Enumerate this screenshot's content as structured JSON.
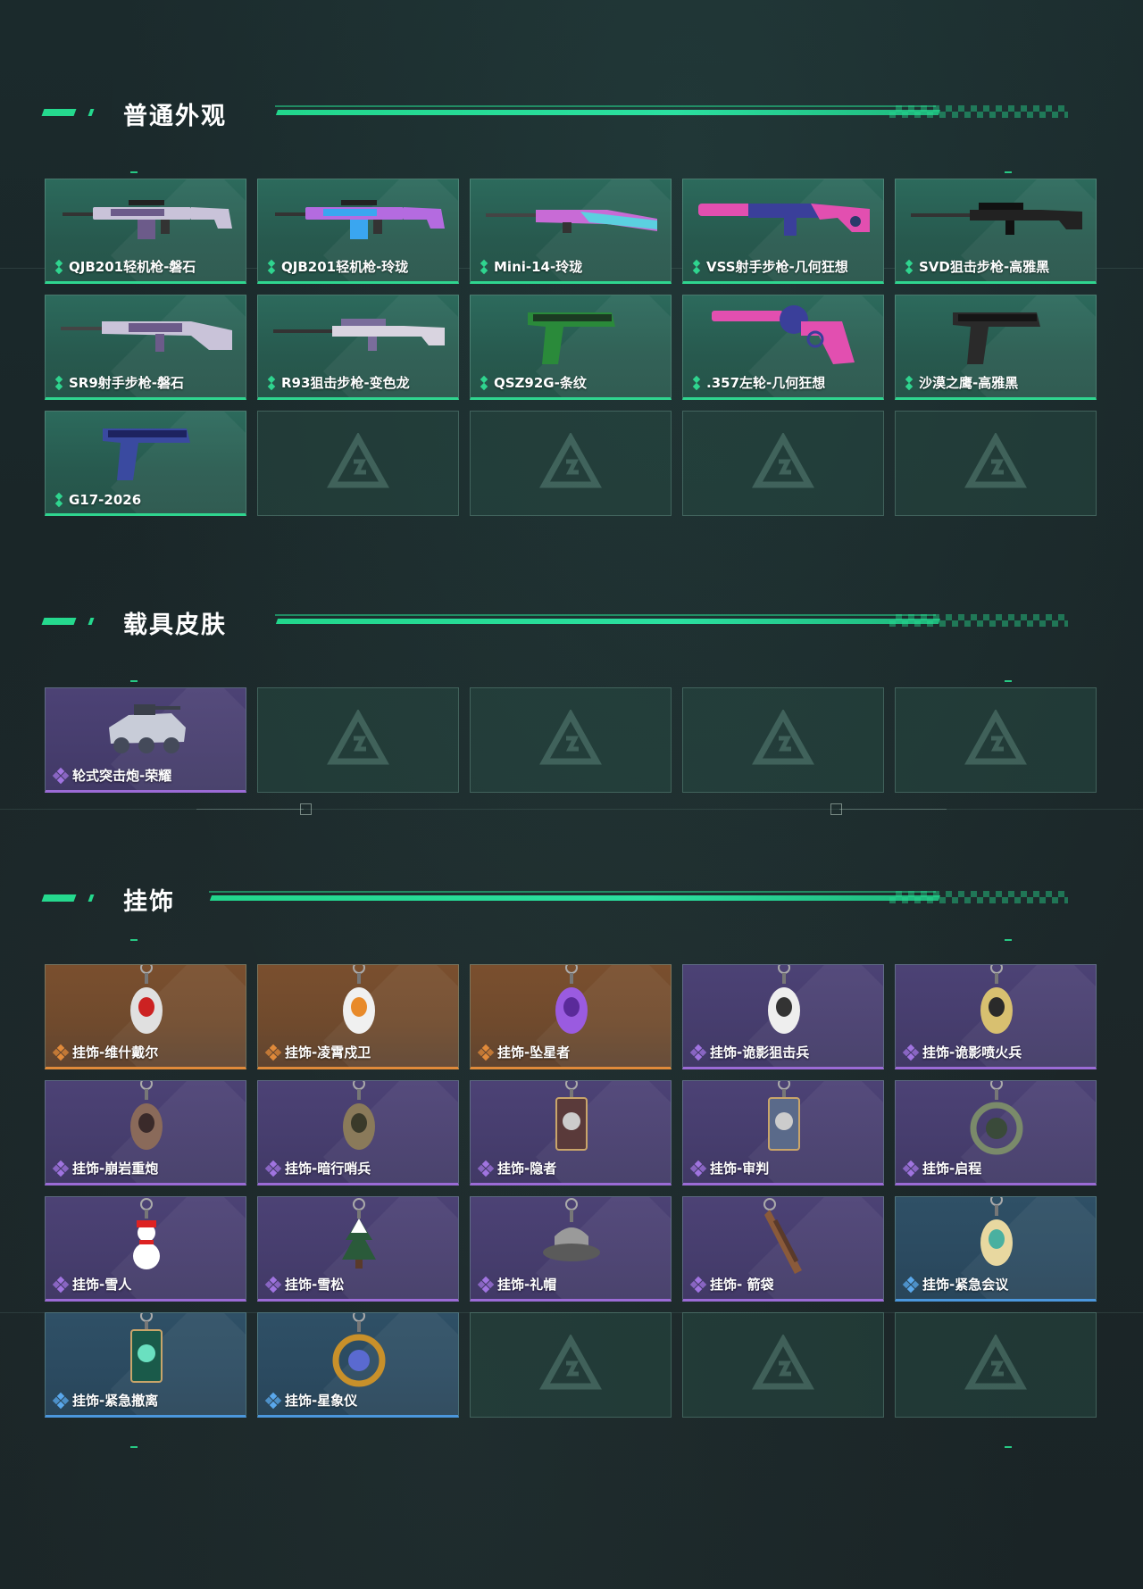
{
  "sections": {
    "normal": {
      "title": "普通外观",
      "items": [
        {
          "label": "QJB201轻机枪-磐石",
          "rarity": "green",
          "icon": "lmg-icon",
          "colors": [
            "#c9c3d9",
            "#6c5b8a"
          ]
        },
        {
          "label": "QJB201轻机枪-玲珑",
          "rarity": "green",
          "icon": "lmg-icon",
          "colors": [
            "#b46be0",
            "#3aa6f0"
          ]
        },
        {
          "label": "Mini-14-玲珑",
          "rarity": "green",
          "icon": "rifle-icon",
          "colors": [
            "#c86bd6",
            "#5bd0e0"
          ]
        },
        {
          "label": "VSS射手步枪-几何狂想",
          "rarity": "green",
          "icon": "vss-icon",
          "colors": [
            "#e24fb0",
            "#3a3f9a"
          ]
        },
        {
          "label": "SVD狙击步枪-高雅黑",
          "rarity": "green",
          "icon": "sniper-icon",
          "colors": [
            "#222",
            "#111"
          ]
        },
        {
          "label": "SR9射手步枪-磐石",
          "rarity": "green",
          "icon": "marksman-icon",
          "colors": [
            "#c9c3d9",
            "#6c5b8a"
          ]
        },
        {
          "label": "R93狙击步枪-变色龙",
          "rarity": "green",
          "icon": "sniper-icon",
          "colors": [
            "#d9d4e0",
            "#7a6d9b"
          ]
        },
        {
          "label": "QSZ92G-条纹",
          "rarity": "green",
          "icon": "pistol-icon",
          "colors": [
            "#2a8a3a",
            "#1b3a22"
          ]
        },
        {
          "label": ".357左轮-几何狂想",
          "rarity": "green",
          "icon": "revolver-icon",
          "colors": [
            "#e24fb0",
            "#3a3f9a"
          ]
        },
        {
          "label": "沙漠之鹰-高雅黑",
          "rarity": "green",
          "icon": "pistol-icon",
          "colors": [
            "#2a2a2a",
            "#151515"
          ]
        },
        {
          "label": "G17-2026",
          "rarity": "green",
          "icon": "pistol-icon",
          "colors": [
            "#3a4aa0",
            "#1d2360"
          ]
        }
      ]
    },
    "vehicle": {
      "title": "载具皮肤",
      "items": [
        {
          "label": "轮式突击炮-荣耀",
          "rarity": "purple",
          "icon": "vehicle-icon",
          "colors": [
            "#c8ccd8",
            "#444a5a"
          ]
        }
      ]
    },
    "charm": {
      "title": "挂饰",
      "items": [
        {
          "label": "挂饰-维什戴尔",
          "rarity": "orange",
          "icon": "charm-icon",
          "colors": [
            "#e0e0e0",
            "#c22"
          ]
        },
        {
          "label": "挂饰-凌霄戍卫",
          "rarity": "orange",
          "icon": "charm-icon",
          "colors": [
            "#f0f0f0",
            "#e88a2a"
          ]
        },
        {
          "label": "挂饰-坠星者",
          "rarity": "orange",
          "icon": "charm-icon",
          "colors": [
            "#9a5be0",
            "#5a2a9a"
          ]
        },
        {
          "label": "挂饰-诡影狙击兵",
          "rarity": "purple",
          "icon": "charm-icon",
          "colors": [
            "#eee",
            "#333"
          ]
        },
        {
          "label": "挂饰-诡影喷火兵",
          "rarity": "purple",
          "icon": "charm-icon",
          "colors": [
            "#d8c070",
            "#2a2a2a"
          ]
        },
        {
          "label": "挂饰-崩岩重炮",
          "rarity": "purple",
          "icon": "charm-icon",
          "colors": [
            "#8a6a5a",
            "#3a2a2a"
          ]
        },
        {
          "label": "挂饰-暗行哨兵",
          "rarity": "purple",
          "icon": "charm-icon",
          "colors": [
            "#8a7a5a",
            "#3a3a2a"
          ]
        },
        {
          "label": "挂饰-隐者",
          "rarity": "purple",
          "icon": "card-charm-icon",
          "colors": [
            "#5a3a3a",
            "#ccc"
          ]
        },
        {
          "label": "挂饰-审判",
          "rarity": "purple",
          "icon": "card-charm-icon",
          "colors": [
            "#5a6a8a",
            "#ccc"
          ]
        },
        {
          "label": "挂饰-启程",
          "rarity": "purple",
          "icon": "ring-charm-icon",
          "colors": [
            "#7a8a6a",
            "#3a4a3a"
          ]
        },
        {
          "label": "挂饰-雪人",
          "rarity": "purple",
          "icon": "snowman-icon",
          "colors": [
            "#ffffff",
            "#d22"
          ]
        },
        {
          "label": "挂饰-雪松",
          "rarity": "purple",
          "icon": "tree-icon",
          "colors": [
            "#2a5a3a",
            "#ffffff"
          ]
        },
        {
          "label": "挂饰-礼帽",
          "rarity": "purple",
          "icon": "hat-icon",
          "colors": [
            "#9a9a9a",
            "#5a5a5a"
          ]
        },
        {
          "label": "挂饰- 箭袋",
          "rarity": "purple",
          "icon": "quiver-icon",
          "colors": [
            "#8a5a3a",
            "#5a3a2a"
          ]
        },
        {
          "label": "挂饰-紧急会议",
          "rarity": "blue",
          "icon": "charm-icon",
          "colors": [
            "#e8d8a0",
            "#4ab0a0"
          ]
        },
        {
          "label": "挂饰-紧急撤离",
          "rarity": "blue",
          "icon": "card-charm-icon",
          "colors": [
            "#1a5a4a",
            "#6ae0c0"
          ]
        },
        {
          "label": "挂饰-星象仪",
          "rarity": "blue",
          "icon": "ring-charm-icon",
          "colors": [
            "#c8902a",
            "#5a6ad0"
          ]
        }
      ]
    }
  },
  "rarity_colors": {
    "green": "#2fd58f",
    "purple": "#a074e0",
    "orange": "#e08a3a",
    "blue": "#5aa8ec"
  },
  "accent": "#25d98e"
}
